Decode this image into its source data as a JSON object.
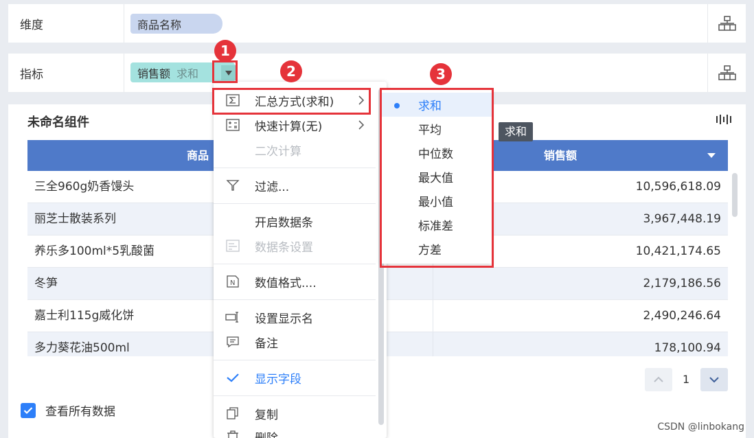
{
  "shelves": {
    "dimension": {
      "label": "维度",
      "pill": "商品名称"
    },
    "metric": {
      "label": "指标",
      "pill": "销售额",
      "pill_sub": "求和"
    }
  },
  "widget": {
    "title": "未命名组件",
    "columns": [
      "商品",
      "销售额"
    ],
    "rows": [
      {
        "name": "三全960g奶香馒头",
        "value": "10,596,618.09"
      },
      {
        "name": "丽芝士散装系列",
        "value": "3,967,448.19"
      },
      {
        "name": "养乐多100ml*5乳酸菌",
        "value": "10,421,174.65"
      },
      {
        "name": "冬笋",
        "value": "2,179,186.56"
      },
      {
        "name": "嘉士利115g威化饼",
        "value": "2,490,246.64"
      },
      {
        "name": "多力葵花油500ml",
        "value": "178,100.94"
      }
    ],
    "pager": {
      "current": "1"
    },
    "view_all_label": "查看所有数据"
  },
  "context_menu": {
    "items": [
      {
        "label": "汇总方式(求和)",
        "icon": "sigma-icon",
        "submenu": true
      },
      {
        "label": "快速计算(无)",
        "icon": "calculator-icon",
        "submenu": true
      },
      {
        "label": "二次计算",
        "disabled": true
      },
      {
        "label": "过滤...",
        "icon": "filter-icon"
      },
      {
        "label": "开启数据条"
      },
      {
        "label": "数据条设置",
        "icon": "databar-icon",
        "disabled": true
      },
      {
        "label": "数值格式....",
        "icon": "number-format-icon"
      },
      {
        "label": "设置显示名",
        "icon": "rename-icon"
      },
      {
        "label": "备注",
        "icon": "comment-icon"
      },
      {
        "label": "显示字段",
        "icon": "check-icon",
        "checked": true
      },
      {
        "label": "复制",
        "icon": "copy-icon"
      },
      {
        "label": "删除",
        "icon": "delete-icon"
      }
    ]
  },
  "aggregation_submenu": {
    "selected": "求和",
    "items": [
      "求和",
      "平均",
      "中位数",
      "最大值",
      "最小值",
      "标准差",
      "方差"
    ]
  },
  "tooltip": "求和",
  "annotations": [
    "1",
    "2",
    "3"
  ],
  "watermark": "CSDN @linbokang",
  "colors": {
    "header_blue": "#4f7ac9",
    "accent_blue": "#2d7ff9",
    "dimension_pill": "#c9d6ef",
    "metric_pill": "#a4e2df",
    "annotation_red": "#e5333a"
  }
}
